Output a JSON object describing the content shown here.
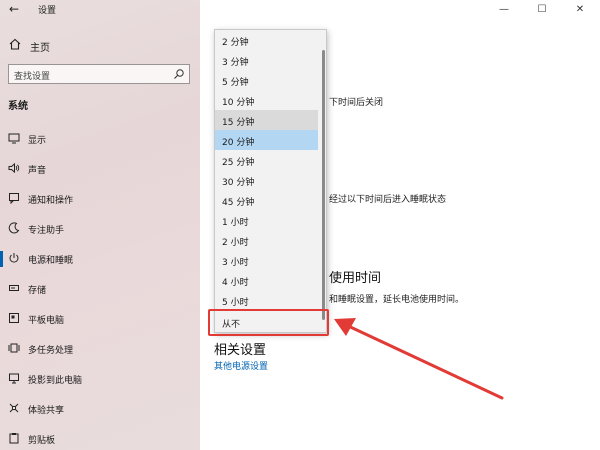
{
  "window": {
    "title": "设置",
    "back_icon": "back-arrow-icon",
    "minimize": "—",
    "maximize": "☐",
    "close": "✕"
  },
  "sidebar": {
    "home_label": "主页",
    "search_placeholder": "查找设置",
    "section_title": "系统",
    "items": [
      {
        "label": "显示",
        "icon": "display-icon"
      },
      {
        "label": "声音",
        "icon": "sound-icon"
      },
      {
        "label": "通知和操作",
        "icon": "notification-icon"
      },
      {
        "label": "专注助手",
        "icon": "focus-assist-icon"
      },
      {
        "label": "电源和睡眠",
        "icon": "power-icon",
        "active": true
      },
      {
        "label": "存储",
        "icon": "storage-icon"
      },
      {
        "label": "平板电脑",
        "icon": "tablet-icon"
      },
      {
        "label": "多任务处理",
        "icon": "multitask-icon"
      },
      {
        "label": "投影到此电脑",
        "icon": "project-icon"
      },
      {
        "label": "体验共享",
        "icon": "share-icon"
      },
      {
        "label": "剪贴板",
        "icon": "clipboard-icon"
      }
    ]
  },
  "content": {
    "partial_text_1": "下时间后关闭",
    "partial_text_2": "经过以下时间后进入睡眠状态",
    "partial_heading": "使用时间",
    "partial_text_3": "和睡眠设置，延长电池使用时间。",
    "related_title": "相关设置",
    "related_link": "其他电源设置"
  },
  "dropdown": {
    "options": [
      "2 分钟",
      "3 分钟",
      "5 分钟",
      "10 分钟",
      "15 分钟",
      "20 分钟",
      "25 分钟",
      "30 分钟",
      "45 分钟",
      "1 小时",
      "2 小时",
      "3 小时",
      "4 小时",
      "5 小时",
      "从不"
    ],
    "hover_index": 4,
    "selected_index": 5
  },
  "colors": {
    "accent": "#0063b1",
    "selected": "#b3d7f3",
    "annotation": "#e23a35"
  }
}
